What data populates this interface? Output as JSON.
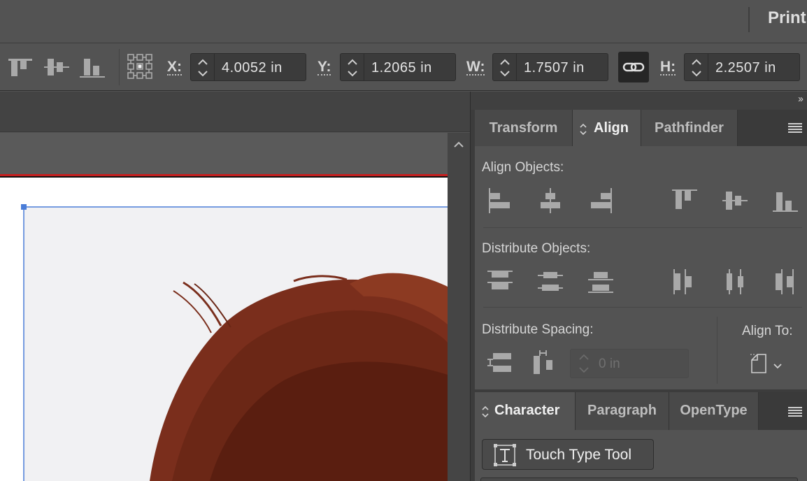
{
  "topbar": {
    "print_label": "Print"
  },
  "controlbar": {
    "x": {
      "label": "X:",
      "value": "4.0052 in"
    },
    "y": {
      "label": "Y:",
      "value": "1.2065 in"
    },
    "w": {
      "label": "W:",
      "value": "1.7507 in"
    },
    "h": {
      "label": "H:",
      "value": "2.2507 in"
    }
  },
  "panel": {
    "collapse_label": "››",
    "tabs": [
      "Transform",
      "Align",
      "Pathfinder"
    ],
    "active_tab": "Align",
    "align_objects_title": "Align Objects:",
    "distribute_objects_title": "Distribute Objects:",
    "distribute_spacing_title": "Distribute Spacing:",
    "spacing_value": "0 in",
    "align_to_title": "Align To:"
  },
  "char_panel": {
    "tabs": [
      "Character",
      "Paragraph",
      "OpenType"
    ],
    "active_tab": "Character",
    "touch_type_label": "Touch Type Tool"
  },
  "colors": {
    "selection": "#4a7dd8",
    "guide": "#c51f1f",
    "panel_bg": "#535353"
  }
}
